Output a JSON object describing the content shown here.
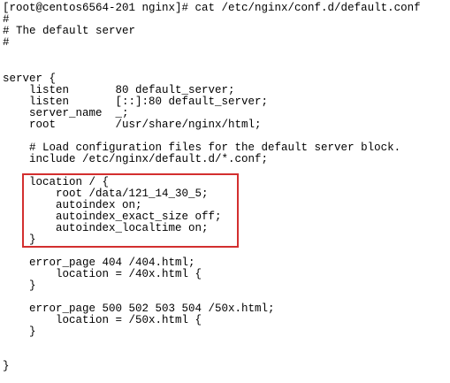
{
  "window": {
    "title": "[root@centos6564-201 nginx]# cat /etc/nginx/conf.d/default.conf"
  },
  "terminal": {
    "lines": [
      "[root@centos6564-201 nginx]# cat /etc/nginx/conf.d/default.conf",
      "#",
      "# The default server",
      "#",
      "",
      "server {",
      "    listen       80 default_server;",
      "    listen       [::]:80 default_server;",
      "    server_name  _;",
      "    root         /usr/share/nginx/html;",
      "",
      "    # Load configuration files for the default server block.",
      "    include /etc/nginx/default.d/*.conf;",
      "",
      "    location / {",
      "        root /data/121_14_30_5;",
      "        autoindex on;",
      "        autoindex_exact_size off;",
      "        autoindex_localtime on;",
      "    }",
      "",
      "    error_page 404 /404.html;",
      "        location = /40x.html {",
      "    }",
      "",
      "    error_page 500 502 503 504 /50x.html;",
      "        location = /50x.html {",
      "    }",
      "",
      "",
      "}"
    ],
    "highlight_color": "#d32f2f"
  }
}
